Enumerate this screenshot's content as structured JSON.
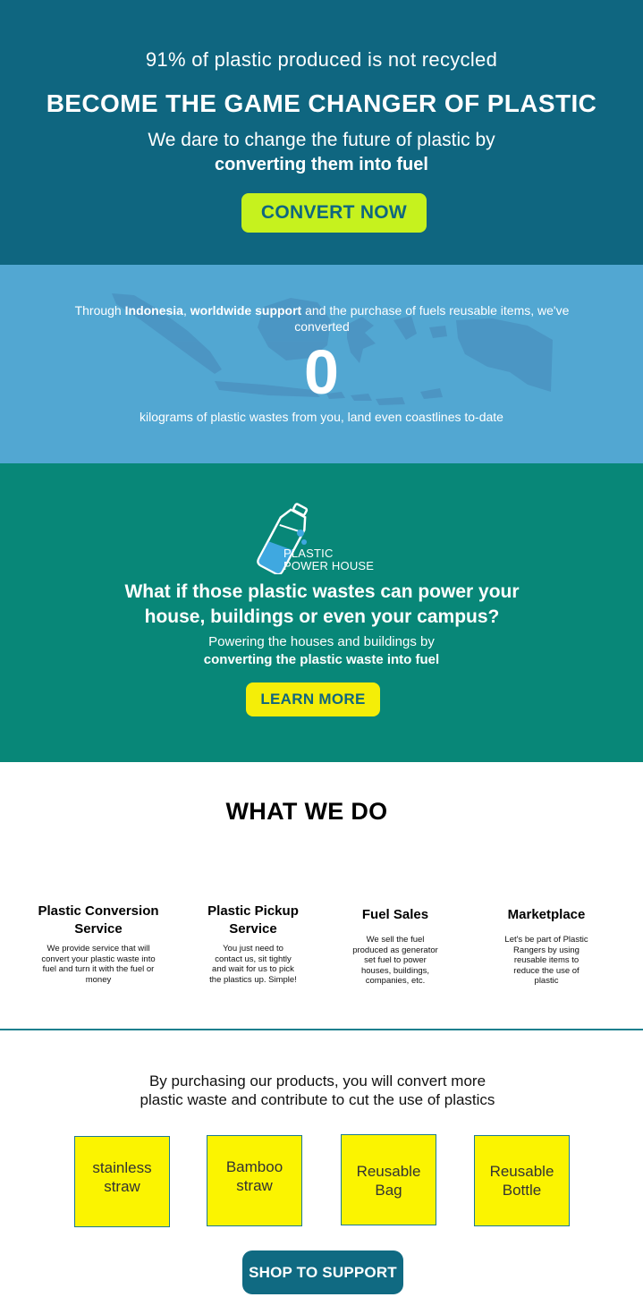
{
  "hero": {
    "kicker": "91% of plastic produced is not recycled",
    "headline": "BECOME THE GAME CHANGER OF PLASTIC",
    "sub_line1": "We dare to change the future of plastic by",
    "sub_line2": "converting them into fuel",
    "cta_label": "CONVERT NOW"
  },
  "counter": {
    "text_prefix": "Through ",
    "text_bold1": "Indonesia",
    "text_sep": ", ",
    "text_bold2": "worldwide support",
    "text_suffix": " and the purchase of fuels reusable items, we've converted",
    "count": "0",
    "unit_text": "kilograms of plastic wastes from you, land even coastlines to-date"
  },
  "power_house": {
    "logo_line1": "PLASTIC",
    "logo_line2": "POWER HOUSE",
    "question_line1": "What if those plastic wastes can power your",
    "question_line2": "house, buildings or even your campus?",
    "desc_line1": "Powering the houses and buildings by",
    "desc_line2": "converting the plastic waste into fuel",
    "cta_label": "LEARN MORE"
  },
  "what_we_do": {
    "title": "WHAT WE DO",
    "services": [
      {
        "title": "Plastic Conversion Service",
        "desc": "We provide service that will convert your plastic waste into fuel and turn it with the fuel or money"
      },
      {
        "title": "Plastic Pickup Service",
        "desc": "You just need to contact us, sit tightly and wait for us to pick the plastics up. Simple!"
      },
      {
        "title": "Fuel Sales",
        "desc": "We sell the fuel produced as generator set fuel to power houses, buildings, companies, etc."
      },
      {
        "title": "Marketplace",
        "desc": "Let's be part of Plastic Rangers by using reusable items to reduce the use of plastic"
      }
    ]
  },
  "products": {
    "intro_line1": "By purchasing our products, you will convert more",
    "intro_line2": "plastic waste and  contribute to cut the use of plastics",
    "items": [
      {
        "line1": "stainless",
        "line2": "straw"
      },
      {
        "line1": "Bamboo",
        "line2": "straw"
      },
      {
        "line1": "Reusable",
        "line2": "Bag"
      },
      {
        "line1": "Reusable",
        "line2": "Bottle"
      }
    ],
    "cta_label": "SHOP TO SUPPORT"
  },
  "colors": {
    "hero_bg": "#0f6680",
    "counter_bg": "#52a7d2",
    "power_bg": "#088778",
    "convert_button": "#c6f21e",
    "learn_button": "#f4ee08",
    "tile_bg": "#fbf400",
    "shop_button": "#106a82"
  },
  "icons": {
    "map": "indonesia-map-icon",
    "logo": "plastic-bottle-logo-icon"
  }
}
